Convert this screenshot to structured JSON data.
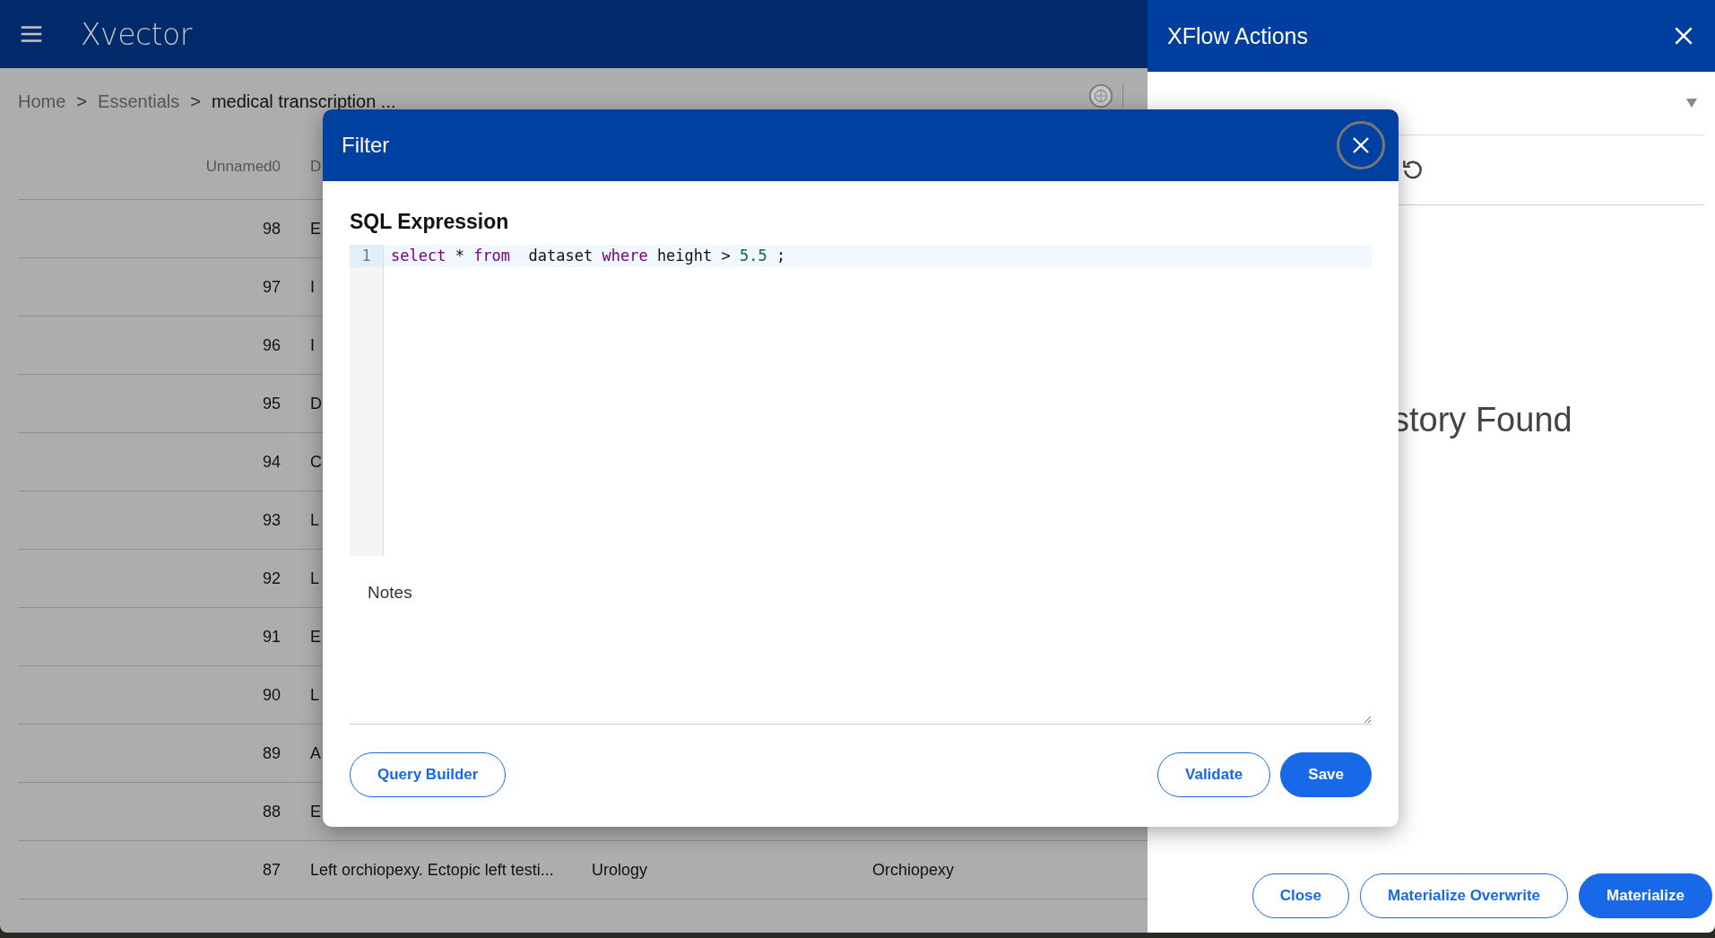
{
  "app_bar": {
    "logo": "Xvector"
  },
  "breadcrumb": {
    "items": [
      {
        "label": "Home",
        "current": false
      },
      {
        "label": "Essentials",
        "current": false
      },
      {
        "label": "medical transcription ..."
      }
    ],
    "separator": ">"
  },
  "table": {
    "columns": [
      "Unnamed0",
      "D"
    ],
    "rows": [
      {
        "cells": [
          "98",
          "E"
        ]
      },
      {
        "cells": [
          "97",
          "I"
        ]
      },
      {
        "cells": [
          "96",
          "I"
        ]
      },
      {
        "cells": [
          "95",
          "D"
        ]
      },
      {
        "cells": [
          "94",
          "C"
        ]
      },
      {
        "cells": [
          "93",
          "L"
        ]
      },
      {
        "cells": [
          "92",
          "L"
        ]
      },
      {
        "cells": [
          "91",
          "E"
        ]
      },
      {
        "cells": [
          "90",
          "L"
        ]
      },
      {
        "cells": [
          "89",
          "A"
        ]
      },
      {
        "cells": [
          "88",
          "E"
        ]
      },
      {
        "cells": [
          "87",
          "Left orchiopexy. Ectopic left testi...",
          "Urology",
          "Orchiopexy"
        ]
      }
    ]
  },
  "filter_dialog": {
    "title": "Filter",
    "section_title": "SQL Expression",
    "editor": {
      "lines": [
        {
          "number": "1",
          "active": true,
          "tokens": [
            {
              "kind": "keyword",
              "text": "select"
            },
            {
              "kind": "plain",
              "text": " * "
            },
            {
              "kind": "keyword",
              "text": "from"
            },
            {
              "kind": "plain",
              "text": "  dataset "
            },
            {
              "kind": "keyword",
              "text": "where"
            },
            {
              "kind": "plain",
              "text": " height > "
            },
            {
              "kind": "number",
              "text": "5.5"
            },
            {
              "kind": "plain",
              "text": " ;"
            }
          ]
        }
      ]
    },
    "notes": {
      "placeholder": "Notes"
    },
    "buttons": [
      {
        "label": "Query Builder",
        "kind": "outline"
      },
      {
        "label": "Validate",
        "kind": "outline"
      },
      {
        "label": "Save",
        "kind": "filled"
      }
    ]
  },
  "xflow_panel": {
    "title": "XFlow Actions",
    "message": "story Found",
    "buttons": [
      {
        "label": "Close",
        "kind": "outline"
      },
      {
        "label": "Materialize Overwrite",
        "kind": "outline"
      },
      {
        "label": "Materialize",
        "kind": "filled"
      }
    ]
  }
}
